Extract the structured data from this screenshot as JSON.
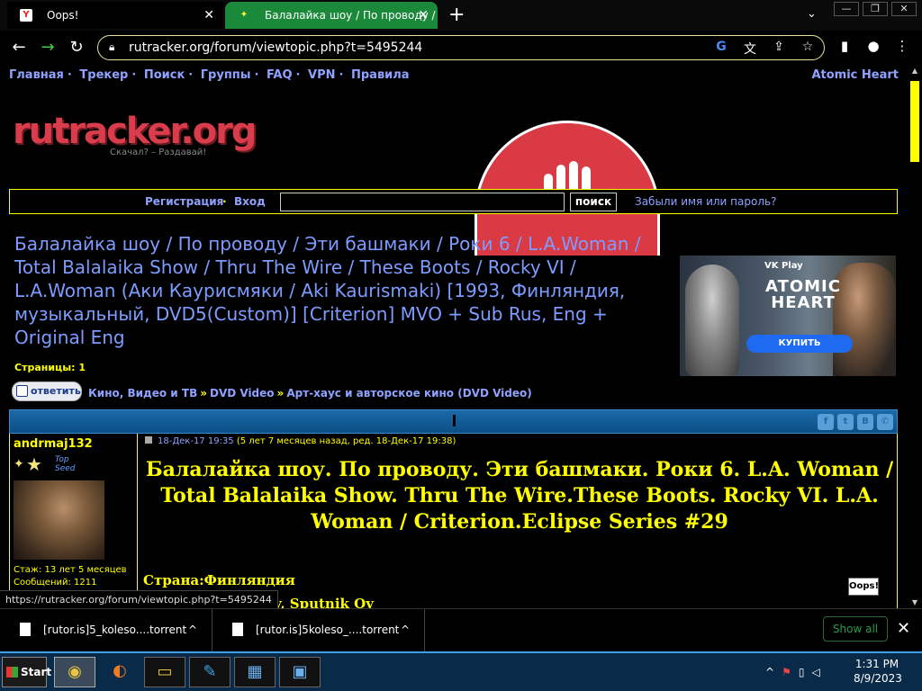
{
  "browser": {
    "tabs": [
      {
        "title": "Oops!",
        "favicon": "Y"
      },
      {
        "title": "Балалайка шоу / По проводу / Эти",
        "favicon": "✦"
      }
    ],
    "new_tab": "+",
    "tab_close": "✕",
    "tab_dropdown": "⌄",
    "url": "rutracker.org/forum/viewtopic.php?t=5495244",
    "window_controls": {
      "minimize": "—",
      "restore": "❐",
      "close": "✕"
    }
  },
  "site": {
    "nav": [
      "Главная",
      "Трекер",
      "Поиск",
      "Группы",
      "FAQ",
      "VPN",
      "Правила"
    ],
    "nav_right": "Atomic Heart",
    "logo_text": "rutracker.org",
    "slogan": "Скачал? – Раздавай!",
    "login": {
      "register": "Регистрация",
      "dot": "·",
      "signin": "Вход",
      "search_button": "поиск",
      "forgot": "Забыли имя или пароль?"
    },
    "topic_title": "Балалайка шоу / По проводу / Эти башмаки / Роки 6 / L.A.Woman / Total Balalaika Show / Thru The Wire / These Boots / Rocky VI / L.A.Woman (Аки Каурисмяки / Aki Kaurismaki) [1993, Финляндия, музыкальный, DVD5(Custom)] [Criterion] MVO + Sub Rus, Eng + Original Eng",
    "pages_label": "Страницы:",
    "pages_value": "1",
    "reply_button": "ответить",
    "breadcrumbs": [
      "Кино, Видео и ТВ",
      "DVD Video",
      "Арт-хаус и авторское кино (DVD Video)"
    ],
    "breadcrumb_sep": "»",
    "ad": {
      "vk": "VK Play",
      "title_line1": "ATOMIC",
      "title_line2": "HEART",
      "buy": "КУПИТЬ"
    }
  },
  "post": {
    "author": "andrmaj132",
    "top_seed": "Top Seed",
    "experience": "Стаж: 13 лет 5 месяцев",
    "messages": "Сообщений: 1211",
    "date": "18-Дек-17 19:35",
    "date_note": "(5 лет 7 месяцев назад, ред. 18-Дек-17 19:38)",
    "title": "Балалайка шоу. По проводу. Эти башмаки. Роки 6. L.A. Woman / Total Balalaika Show. Thru The Wire.These Boots. Rocky VI. L.A. Woman / Criterion.Eclipse Series #29",
    "country": "Страна:Финляндия",
    "studio_partial": "sual Oy, Sputnik Oy",
    "share_icons": [
      "f",
      "t",
      "B",
      "✆"
    ],
    "oops_badge": "Oops!"
  },
  "status_url": "https://rutracker.org/forum/viewtopic.php?t=5495244",
  "downloads": {
    "items": [
      "[rutor.is]5_koleso....torrent",
      "[rutor.is]5koleso_....torrent"
    ],
    "show_all": "Show all",
    "close": "✕"
  },
  "taskbar": {
    "start": "Start",
    "time": "1:31 PM",
    "date": "8/9/2023"
  },
  "colors": {
    "link": "#8fa2ff",
    "accent_yellow": "#ffff00",
    "post_header": "#1b6aa8",
    "logo_red": "#d93c4a"
  }
}
